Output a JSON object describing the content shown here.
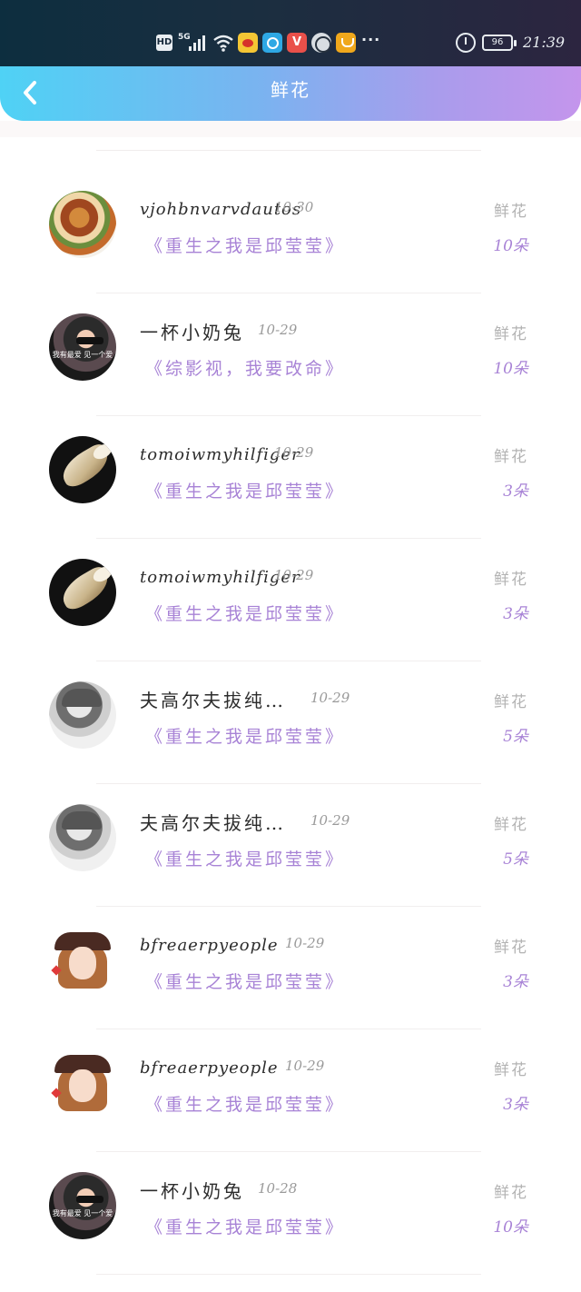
{
  "status_bar": {
    "hd": "HD",
    "network": "5G",
    "more": "···",
    "battery": "96",
    "time": "21:39"
  },
  "header": {
    "title": "鲜花"
  },
  "rows": [
    {
      "user": "vjohbnvarvdautos",
      "date": "10-30",
      "gift": "鲜花",
      "book": "《重生之我是邱莹莹》",
      "count": "10朵",
      "avatar": "food"
    },
    {
      "user": "一杯小奶兔",
      "date": "10-29",
      "gift": "鲜花",
      "book": "《综影视，我要改命》",
      "count": "10朵",
      "avatar": "girl-dark"
    },
    {
      "user": "tomoiwmyhilfiger",
      "date": "10-29",
      "gift": "鲜花",
      "book": "《重生之我是邱莹莹》",
      "count": "3朵",
      "avatar": "shell"
    },
    {
      "user": "tomoiwmyhilfiger",
      "date": "10-29",
      "gift": "鲜花",
      "book": "《重生之我是邱莹莹》",
      "count": "3朵",
      "avatar": "shell"
    },
    {
      "user": "夫高尔夫拔纯…",
      "date": "10-29",
      "gift": "鲜花",
      "book": "《重生之我是邱莹莹》",
      "count": "5朵",
      "avatar": "sketch"
    },
    {
      "user": "夫高尔夫拔纯…",
      "date": "10-29",
      "gift": "鲜花",
      "book": "《重生之我是邱莹莹》",
      "count": "5朵",
      "avatar": "sketch"
    },
    {
      "user": "bfreaerpyeople",
      "date": "10-29",
      "gift": "鲜花",
      "book": "《重生之我是邱莹莹》",
      "count": "3朵",
      "avatar": "cartoon"
    },
    {
      "user": "bfreaerpyeople",
      "date": "10-29",
      "gift": "鲜花",
      "book": "《重生之我是邱莹莹》",
      "count": "3朵",
      "avatar": "cartoon"
    },
    {
      "user": "一杯小奶兔",
      "date": "10-28",
      "gift": "鲜花",
      "book": "《重生之我是邱莹莹》",
      "count": "10朵",
      "avatar": "girl-dark"
    }
  ],
  "avatar_caption": "我有最爱 见一个爱"
}
